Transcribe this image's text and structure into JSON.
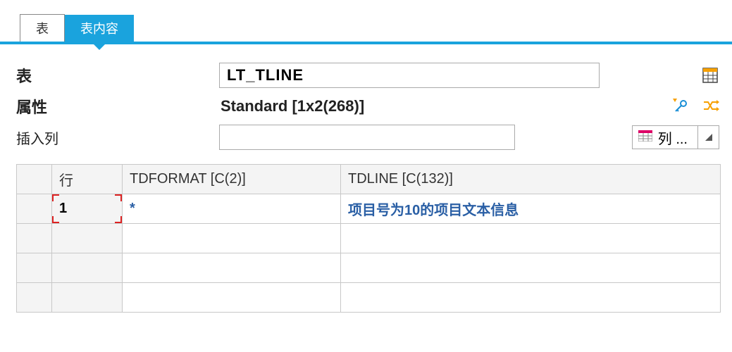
{
  "tabs": {
    "inactive": "表",
    "active": "表内容"
  },
  "form": {
    "table_label": "表",
    "table_value": "LT_TLINE",
    "attr_label": "属性",
    "attr_value": "Standard [1x2(268)]",
    "insert_label": "插入列",
    "insert_value": "",
    "col_dropdown": "列 ..."
  },
  "grid": {
    "headers": {
      "row": "行",
      "tdformat": "TDFORMAT [C(2)]",
      "tdline": "TDLINE [C(132)]"
    },
    "rows": [
      {
        "n": "1",
        "tdformat": "*",
        "tdline": "项目号为10的项目文本信息"
      },
      {
        "n": "",
        "tdformat": "",
        "tdline": ""
      },
      {
        "n": "",
        "tdformat": "",
        "tdline": ""
      },
      {
        "n": "",
        "tdformat": "",
        "tdline": ""
      }
    ]
  }
}
